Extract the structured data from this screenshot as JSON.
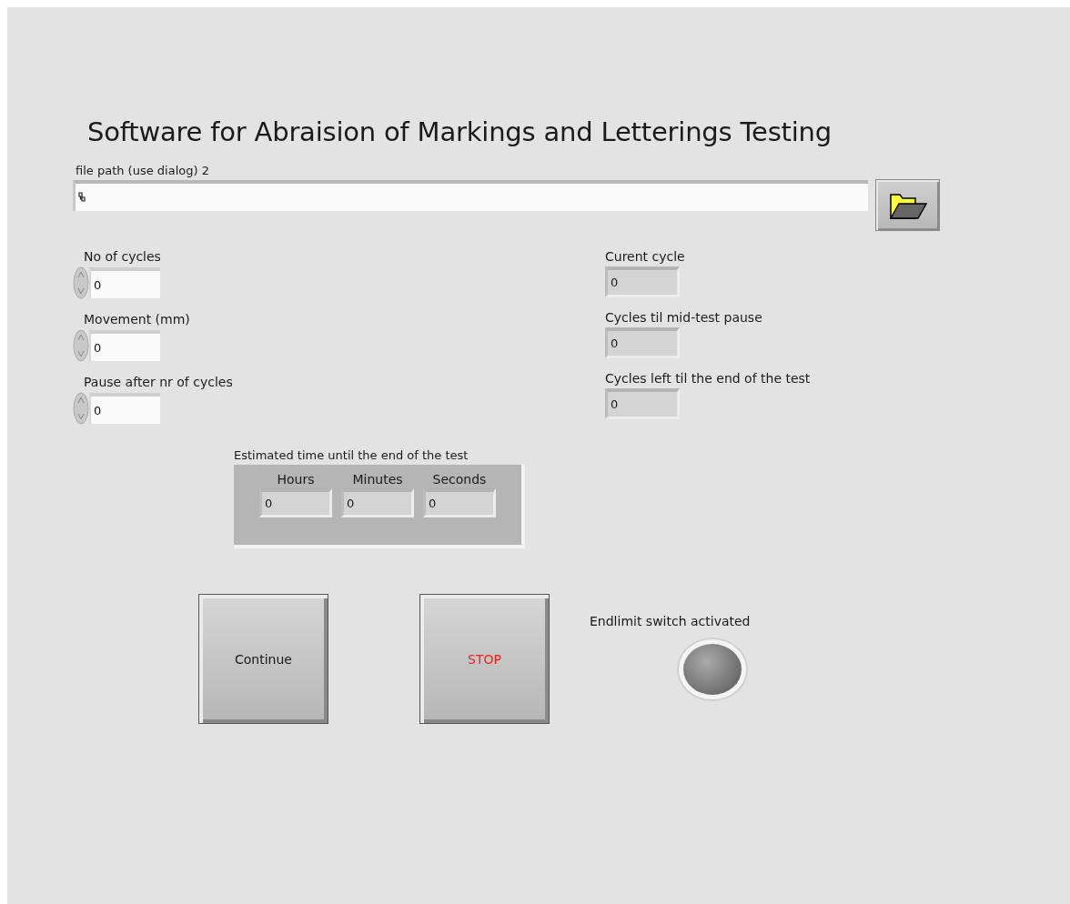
{
  "title": "Software for Abraision of Markings and Letterings Testing",
  "file_path": {
    "label": "file path (use dialog) 2"
  },
  "controls": [
    {
      "label": "No of cycles",
      "value": "0"
    },
    {
      "label": "Movement (mm)",
      "value": "0"
    },
    {
      "label": "Pause after nr of cycles",
      "value": "0"
    }
  ],
  "indicators": [
    {
      "label": "Curent cycle",
      "value": "0"
    },
    {
      "label": "Cycles til mid-test pause",
      "value": "0"
    },
    {
      "label": "Cycles left til the end of the test",
      "value": "0"
    }
  ],
  "estimated_time": {
    "label": "Estimated time until the end of the test",
    "fields": [
      {
        "label": "Hours",
        "value": "0"
      },
      {
        "label": "Minutes",
        "value": "0"
      },
      {
        "label": "Seconds",
        "value": "0"
      }
    ]
  },
  "buttons": [
    {
      "label": "Continue",
      "color": "#1a1a1a"
    },
    {
      "label": "STOP",
      "color": "#ff1a1a"
    }
  ],
  "endlimit": {
    "label": "Endlimit switch activated",
    "on": false
  }
}
